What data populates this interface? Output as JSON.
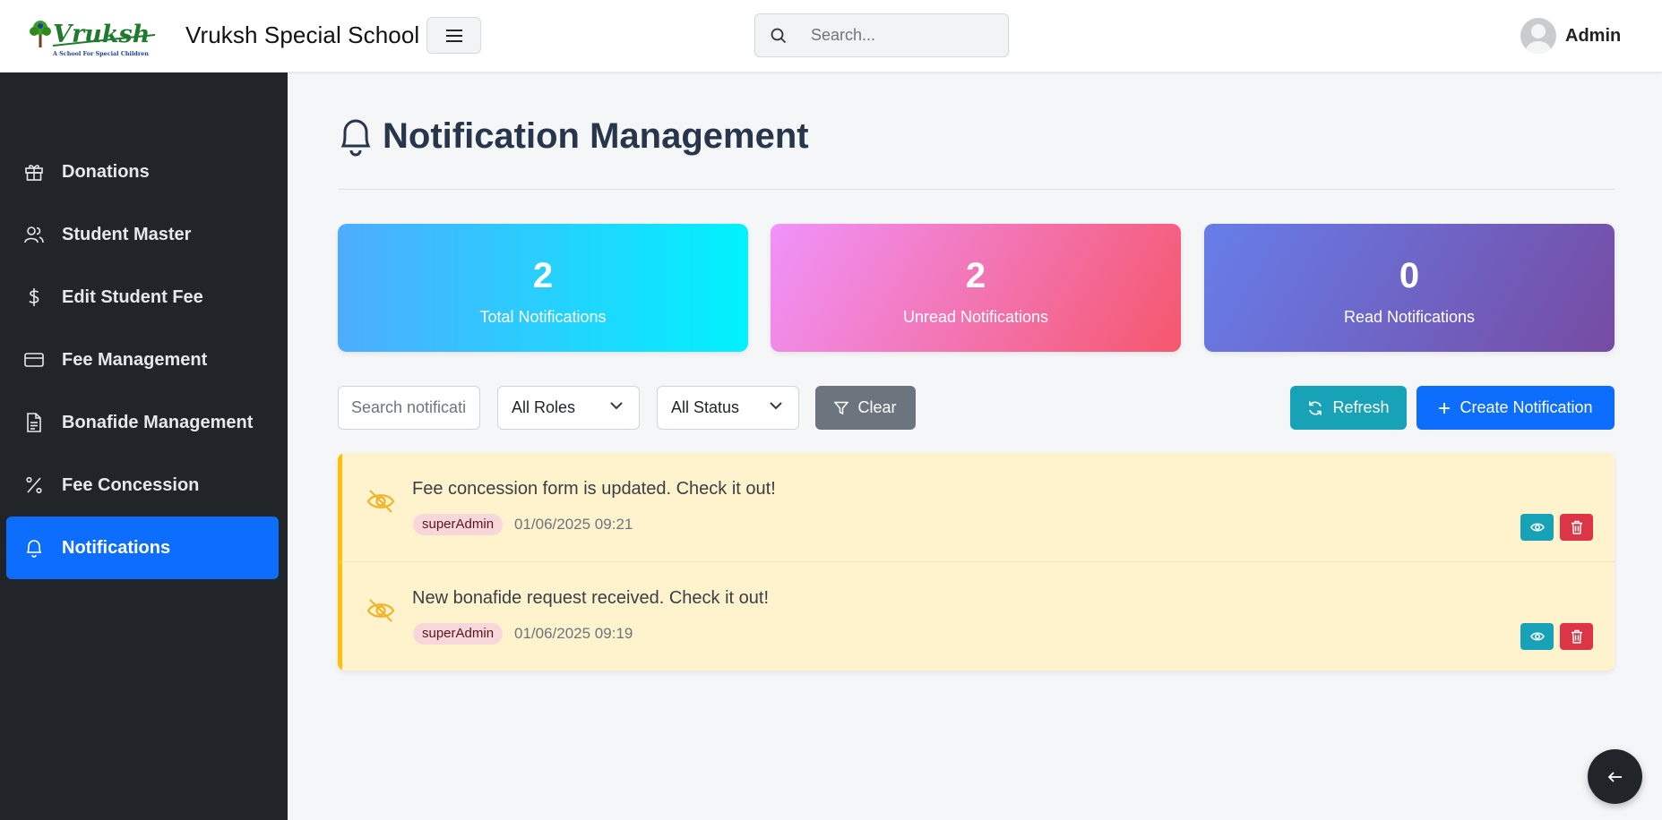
{
  "header": {
    "brand": "Vruksh Special School",
    "logo_text": "Vruksh",
    "logo_tagline": "A School For Special Children",
    "search_placeholder": "Search...",
    "user_name": "Admin"
  },
  "sidebar": {
    "items": [
      {
        "label": "Donations",
        "icon": "gift-icon",
        "active": false
      },
      {
        "label": "Student Master",
        "icon": "users-icon",
        "active": false
      },
      {
        "label": "Edit Student Fee",
        "icon": "dollar-icon",
        "active": false
      },
      {
        "label": "Fee Management",
        "icon": "credit-card-icon",
        "active": false
      },
      {
        "label": "Bonafide Management",
        "icon": "document-icon",
        "active": false
      },
      {
        "label": "Fee Concession",
        "icon": "percent-icon",
        "active": false
      },
      {
        "label": "Notifications",
        "icon": "bell-icon",
        "active": true
      }
    ]
  },
  "main": {
    "title": "Notification Management",
    "stats": [
      {
        "value": "2",
        "label": "Total Notifications"
      },
      {
        "value": "2",
        "label": "Unread Notifications"
      },
      {
        "value": "0",
        "label": "Read Notifications"
      }
    ],
    "filters": {
      "search_placeholder": "Search notifications...",
      "role_selected": "All Roles",
      "status_selected": "All Status",
      "clear_label": "Clear"
    },
    "actions": {
      "refresh_label": "Refresh",
      "create_label": "Create Notification"
    },
    "notifications": [
      {
        "message": "Fee concession form is updated. Check it out!",
        "role": "superAdmin",
        "timestamp": "01/06/2025 09:21",
        "status": "unread"
      },
      {
        "message": "New bonafide request received. Check it out!",
        "role": "superAdmin",
        "timestamp": "01/06/2025 09:19",
        "status": "unread"
      }
    ]
  },
  "colors": {
    "sidebar_bg": "#212529",
    "active_nav": "#0d6efd",
    "unread_row": "#fff3cd",
    "unread_border": "#ffc107",
    "info": "#17a2b8",
    "danger": "#dc3545",
    "secondary": "#6c757d"
  }
}
